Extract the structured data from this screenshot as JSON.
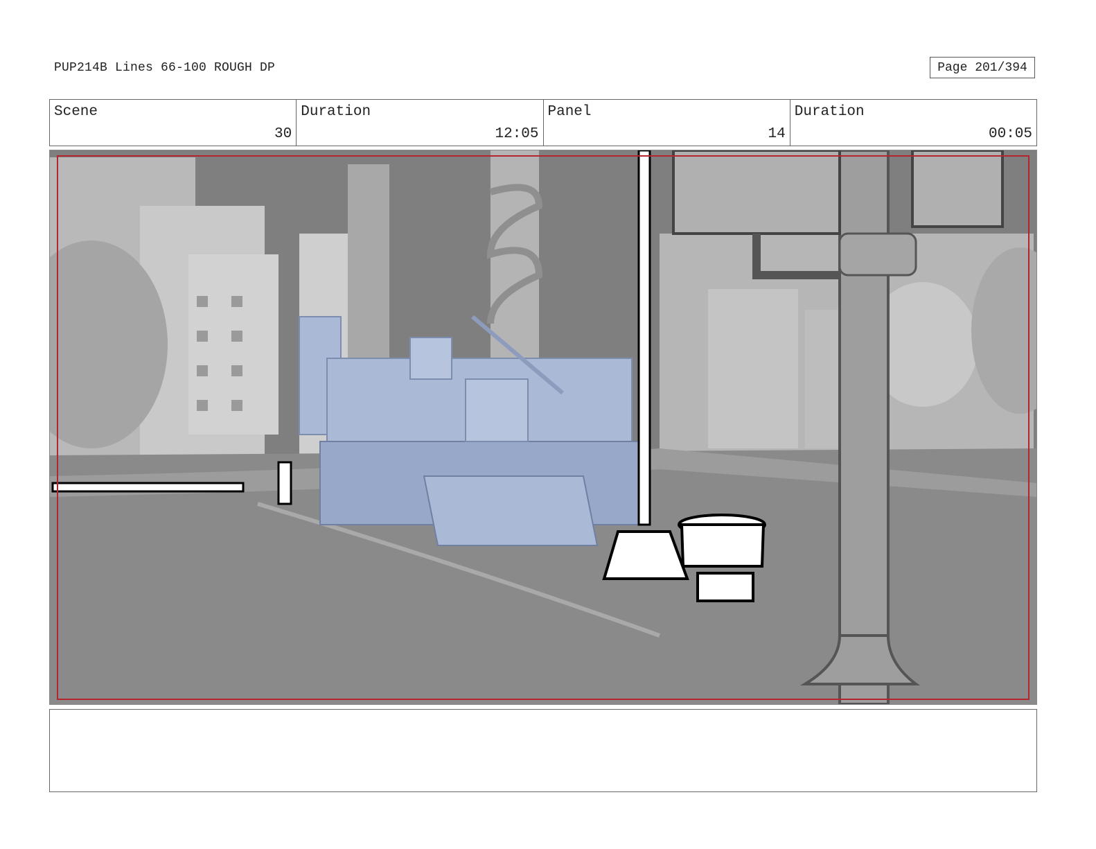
{
  "header": {
    "title": "PUP214B Lines 66-100 ROUGH DP",
    "page": "Page 201/394"
  },
  "info": {
    "scene_label": "Scene",
    "scene_value": "30",
    "scene_duration_label": "Duration",
    "scene_duration_value": "12:05",
    "panel_label": "Panel",
    "panel_value": "14",
    "panel_duration_label": "Duration",
    "panel_duration_value": "00:05"
  },
  "notes": {
    "text": ""
  },
  "colors": {
    "safe_frame": "#b3262e",
    "vehicle": "#a9b9d6",
    "background_render": "#8d8d8d"
  }
}
